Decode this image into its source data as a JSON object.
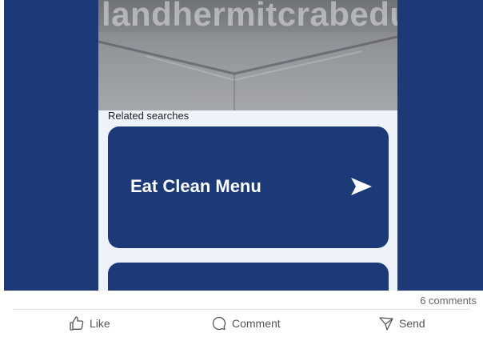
{
  "post": {
    "hero_text": "landhermitcrabeduc",
    "related_label": "Related searches",
    "cards": [
      {
        "title": "Eat Clean Menu",
        "icon": "arrow-right-icon"
      },
      {
        "title": ""
      }
    ]
  },
  "social": {
    "comments_count": "6 comments",
    "actions": {
      "like": "Like",
      "comment": "Comment",
      "send": "Send"
    }
  },
  "colors": {
    "brand_blue": "#1d3a78",
    "panel_bg": "#eef3fb",
    "text_muted": "#555555"
  }
}
